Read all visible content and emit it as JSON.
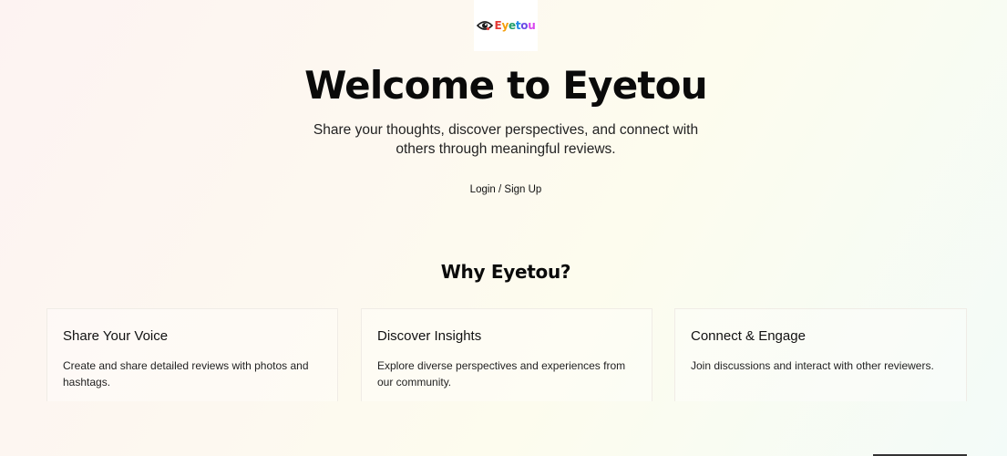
{
  "header": {
    "logo_text": "Eyetou",
    "logo_icon": "eye-icon",
    "colors": {
      "eye": "#1a1a1a",
      "logo_E": "#e53935",
      "logo_y": "#f59e0b",
      "logo_e": "#22a06b",
      "logo_t": "#1e88e5",
      "logo_o": "#6b4ce6",
      "logo_u": "#d946ef"
    }
  },
  "hero": {
    "title": "Welcome to Eyetou",
    "subtitle": "Share your thoughts, discover perspectives, and connect with others through meaningful reviews.",
    "login_label": "Login / Sign Up"
  },
  "features": {
    "title": "Why Eyetou?",
    "items": [
      {
        "title": "Share Your Voice",
        "description": "Create and share detailed reviews with photos and hashtags."
      },
      {
        "title": "Discover Insights",
        "description": "Explore diverse perspectives and experiences from our community."
      },
      {
        "title": "Connect & Engage",
        "description": "Join discussions and interact with other reviewers."
      }
    ]
  }
}
